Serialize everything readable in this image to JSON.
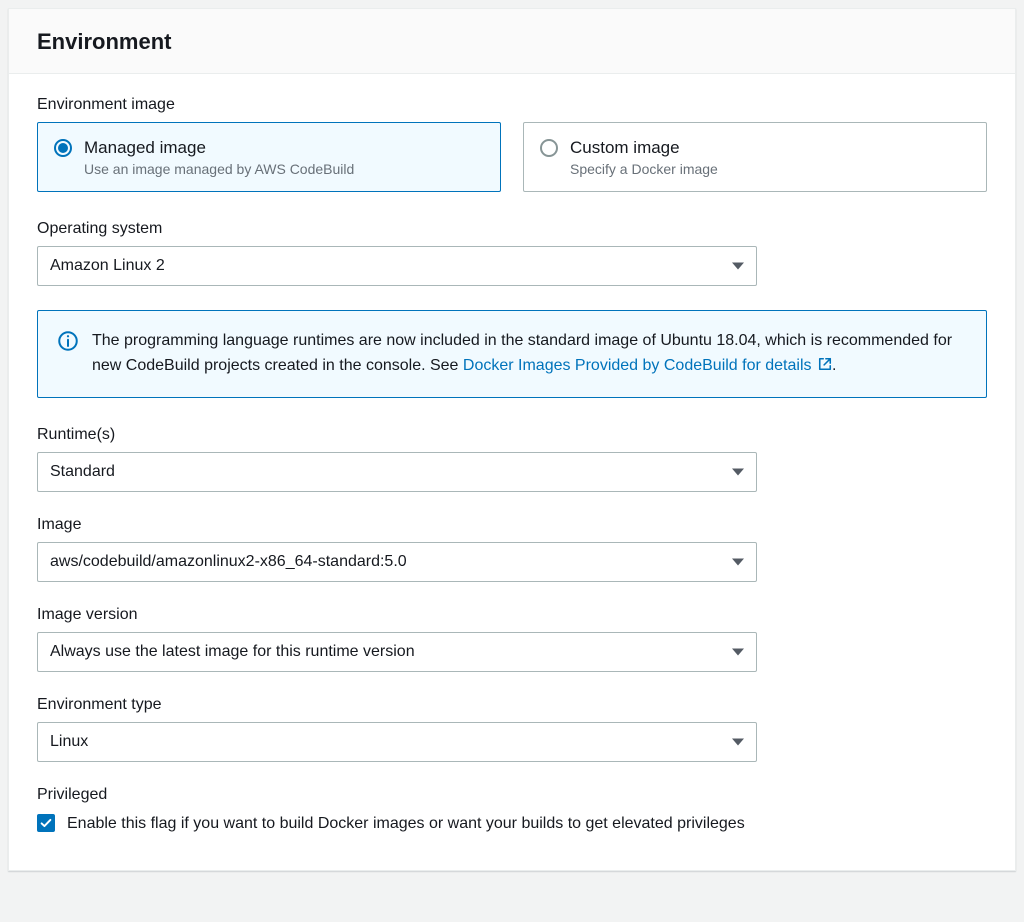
{
  "panel": {
    "title": "Environment"
  },
  "env_image": {
    "label": "Environment image",
    "managed": {
      "title": "Managed image",
      "desc": "Use an image managed by AWS CodeBuild"
    },
    "custom": {
      "title": "Custom image",
      "desc": "Specify a Docker image"
    }
  },
  "os": {
    "label": "Operating system",
    "value": "Amazon Linux 2"
  },
  "info": {
    "text_before_link": "The programming language runtimes are now included in the standard image of Ubuntu 18.04, which is recommended for new CodeBuild projects created in the console. See ",
    "link_text": "Docker Images Provided by CodeBuild for details",
    "period": "."
  },
  "runtime": {
    "label": "Runtime(s)",
    "value": "Standard"
  },
  "image": {
    "label": "Image",
    "value": "aws/codebuild/amazonlinux2-x86_64-standard:5.0"
  },
  "image_version": {
    "label": "Image version",
    "value": "Always use the latest image for this runtime version"
  },
  "env_type": {
    "label": "Environment type",
    "value": "Linux"
  },
  "privileged": {
    "label": "Privileged",
    "text": "Enable this flag if you want to build Docker images or want your builds to get elevated privileges"
  }
}
